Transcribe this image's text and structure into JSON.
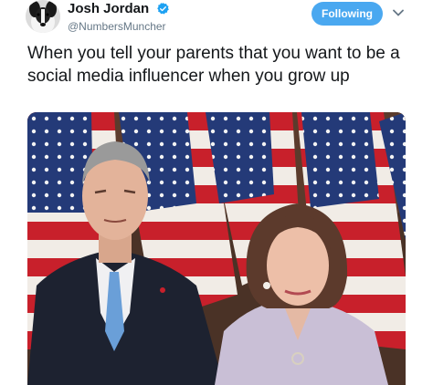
{
  "tweet": {
    "author": {
      "display_name": "Josh Jordan",
      "handle": "@NumbersMuncher",
      "verified": true,
      "avatar_icon": "dog-avatar-icon"
    },
    "follow_button": {
      "label": "Following",
      "color": "#4aa8f0"
    },
    "menu_icon": "chevron-down-icon",
    "text": "When you tell your parents that you want to be a social media influencer when you grow up",
    "media": {
      "type": "photo",
      "description_icon": "two-people-in-front-of-flags-photo"
    }
  }
}
